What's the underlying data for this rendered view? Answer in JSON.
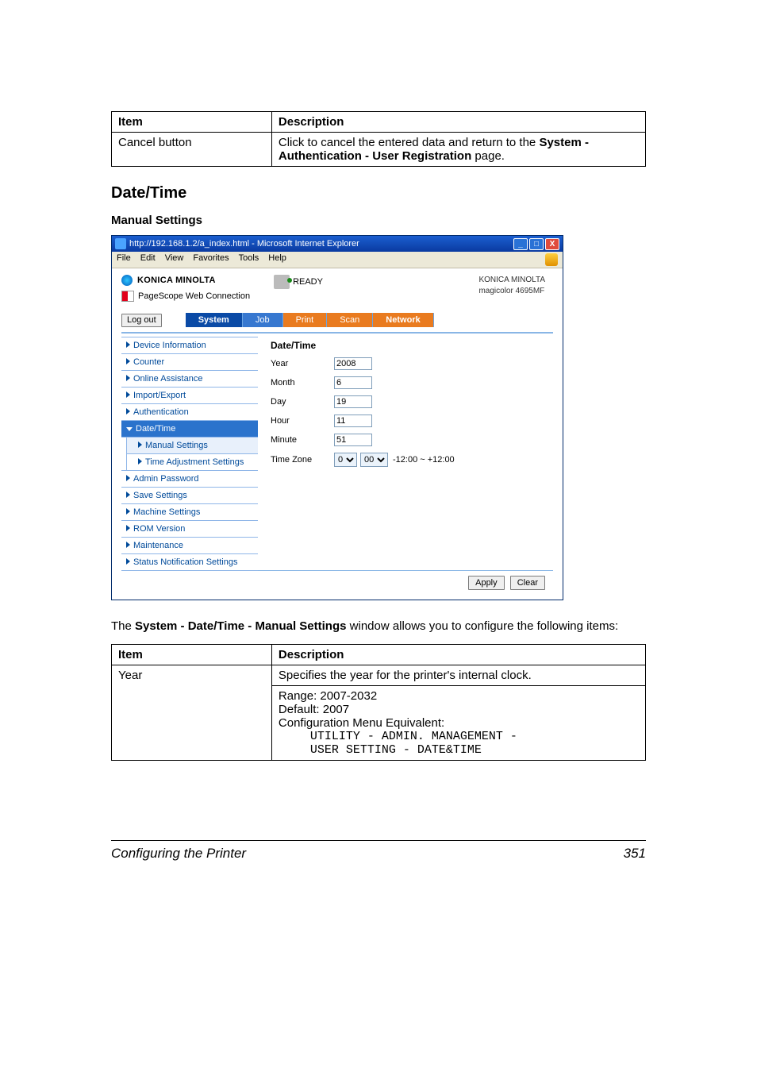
{
  "table1": {
    "header_item": "Item",
    "header_desc": "Description",
    "rows": [
      {
        "item": "Cancel button",
        "desc_pre": "Click to cancel the entered data and return to the ",
        "desc_bold": "System - Authentication - User Registration",
        "desc_post": " page."
      }
    ]
  },
  "section_heading": "Date/Time",
  "sub_heading": "Manual Settings",
  "browser": {
    "title": "http://192.168.1.2/a_index.html - Microsoft Internet Explorer",
    "menu": [
      "File",
      "Edit",
      "View",
      "Favorites",
      "Tools",
      "Help"
    ],
    "brand": "KONICA MINOLTA",
    "subbrand": "PageScope Web Connection",
    "status": "READY",
    "model_line1": "KONICA MINOLTA",
    "model_line2": "magicolor 4695MF",
    "logout": "Log out",
    "tabs": {
      "system": "System",
      "job": "Job",
      "print": "Print",
      "scan": "Scan",
      "network": "Network"
    },
    "nav": {
      "device": "Device Information",
      "counter": "Counter",
      "online": "Online Assistance",
      "importexport": "Import/Export",
      "auth": "Authentication",
      "datetime": "Date/Time",
      "manual": "Manual Settings",
      "timeadj": "Time Adjustment Settings",
      "adminpw": "Admin Password",
      "save": "Save Settings",
      "machine": "Machine Settings",
      "rom": "ROM Version",
      "maint": "Maintenance",
      "status": "Status Notification Settings"
    },
    "form": {
      "heading": "Date/Time",
      "year_lbl": "Year",
      "year_val": "2008",
      "month_lbl": "Month",
      "month_val": "6",
      "day_lbl": "Day",
      "day_val": "19",
      "hour_lbl": "Hour",
      "hour_val": "11",
      "minute_lbl": "Minute",
      "minute_val": "51",
      "tz_lbl": "Time Zone",
      "tz_h": "0",
      "tz_m": "00",
      "tz_range": "-12:00 ~ +12:00"
    },
    "apply": "Apply",
    "clear": "Clear"
  },
  "caption_pre": "The ",
  "caption_bold": "System - Date/Time - Manual Settings",
  "caption_post": " window allows you to configure the following items:",
  "table2": {
    "header_item": "Item",
    "header_desc": "Description",
    "row": {
      "item": "Year",
      "line1": "Specifies the year for the printer's internal clock.",
      "range": "Range:  2007-2032",
      "default": "Default:  2007",
      "cfg": "Configuration Menu Equivalent:",
      "code1": "UTILITY - ADMIN. MANAGEMENT - ",
      "code2": "USER SETTING - DATE&TIME"
    }
  },
  "footer": {
    "left": "Configuring the Printer",
    "right": "351"
  }
}
